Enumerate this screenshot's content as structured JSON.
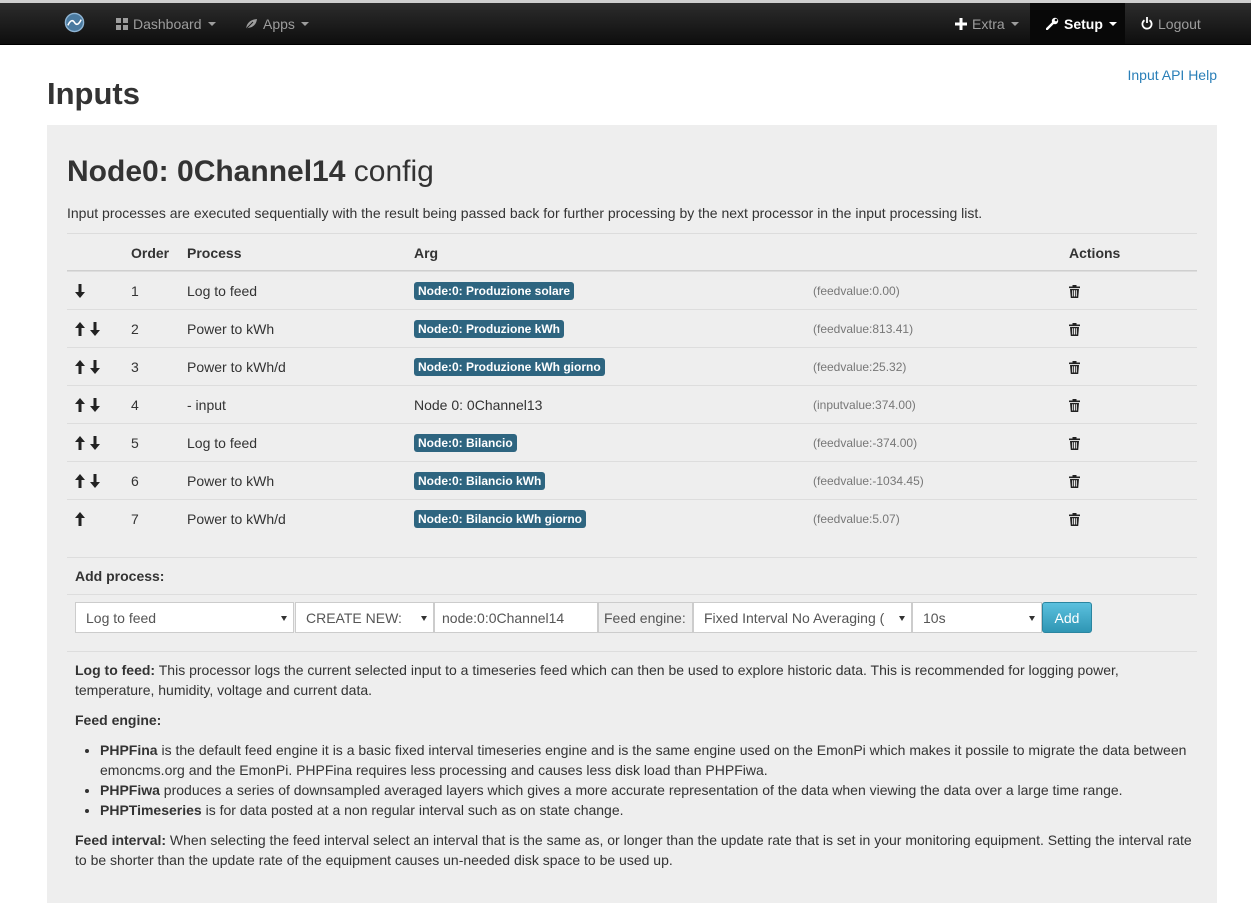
{
  "nav": {
    "dashboard": "Dashboard",
    "apps": "Apps",
    "extra": "Extra",
    "setup": "Setup",
    "logout": "Logout"
  },
  "page": {
    "title": "Inputs",
    "api_help": "Input API Help"
  },
  "node": {
    "name": "Node0: 0Channel14",
    "suffix": "config",
    "intro": "Input processes are executed sequentially with the result being passed back for further processing by the next processor in the input processing list."
  },
  "table": {
    "headers": {
      "order": "Order",
      "process": "Process",
      "arg": "Arg",
      "actions": "Actions"
    },
    "rows": [
      {
        "order": "1",
        "process": "Log to feed",
        "arg": "Node:0: Produzione solare",
        "arg_is_label": true,
        "value": "(feedvalue:0.00)",
        "up": false,
        "down": true
      },
      {
        "order": "2",
        "process": "Power to kWh",
        "arg": "Node:0: Produzione kWh",
        "arg_is_label": true,
        "value": "(feedvalue:813.41)",
        "up": true,
        "down": true
      },
      {
        "order": "3",
        "process": "Power to kWh/d",
        "arg": "Node:0: Produzione kWh giorno",
        "arg_is_label": true,
        "value": "(feedvalue:25.32)",
        "up": true,
        "down": true
      },
      {
        "order": "4",
        "process": "- input",
        "arg": "Node 0: 0Channel13",
        "arg_is_label": false,
        "value": "(inputvalue:374.00)",
        "up": true,
        "down": true
      },
      {
        "order": "5",
        "process": "Log to feed",
        "arg": "Node:0: Bilancio",
        "arg_is_label": true,
        "value": "(feedvalue:-374.00)",
        "up": true,
        "down": true
      },
      {
        "order": "6",
        "process": "Power to kWh",
        "arg": "Node:0: Bilancio kWh",
        "arg_is_label": true,
        "value": "(feedvalue:-1034.45)",
        "up": true,
        "down": true
      },
      {
        "order": "7",
        "process": "Power to kWh/d",
        "arg": "Node:0: Bilancio kWh giorno",
        "arg_is_label": true,
        "value": "(feedvalue:5.07)",
        "up": true,
        "down": false
      }
    ]
  },
  "add_process": {
    "heading": "Add process:",
    "process_select": "Log to feed",
    "feed_select": "CREATE NEW:",
    "feed_name_value": "node:0:0Channel14",
    "engine_label": "Feed engine:",
    "engine_select": "Fixed Interval No Averaging (",
    "interval_select": "10s",
    "add_button": "Add"
  },
  "help": {
    "log_to_feed_term": "Log to feed:",
    "log_to_feed_text": " This processor logs the current selected input to a timeseries feed which can then be used to explore historic data. This is recommended for logging power, temperature, humidity, voltage and current data.",
    "feed_engine_term": "Feed engine:",
    "engines": [
      {
        "term": "PHPFina",
        "text": " is the default feed engine it is a basic fixed interval timeseries engine and is the same engine used on the EmonPi which makes it possile to migrate the data between emoncms.org and the EmonPi. PHPFina requires less processing and causes less disk load than PHPFiwa."
      },
      {
        "term": "PHPFiwa",
        "text": " produces a series of downsampled averaged layers which gives a more accurate representation of the data when viewing the data over a large time range."
      },
      {
        "term": "PHPTimeseries",
        "text": " is for data posted at a non regular interval such as on state change."
      }
    ],
    "feed_interval_term": "Feed interval:",
    "feed_interval_text": " When selecting the feed interval select an interval that is the same as, or longer than the update rate that is set in your monitoring equipment. Setting the interval rate to be shorter than the update rate of the equipment causes un-needed disk space to be used up."
  }
}
